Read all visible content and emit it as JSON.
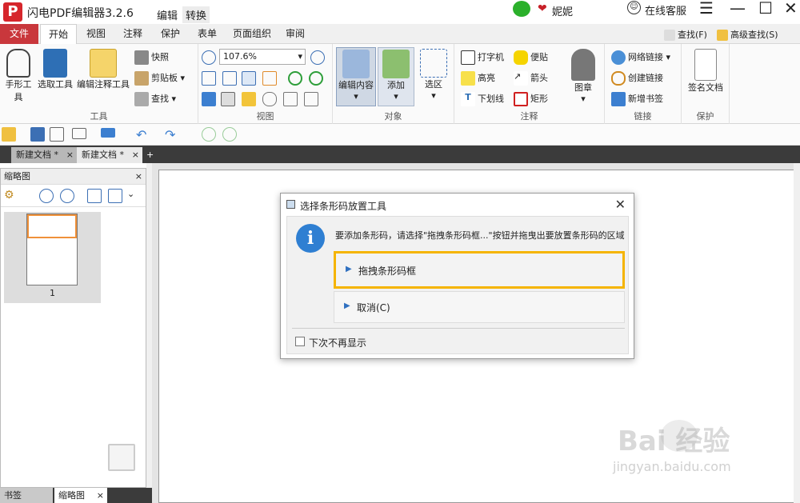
{
  "app": {
    "title": "闪电PDF编辑器3.2.6",
    "logo_text": "P",
    "menu": [
      "编辑",
      "转换"
    ],
    "user": "妮妮",
    "online_service": "在线客服"
  },
  "tabs": [
    "文件",
    "开始",
    "视图",
    "注释",
    "保护",
    "表单",
    "页面组织",
    "审阅"
  ],
  "ribbon_right": {
    "find": "查找(F)",
    "advanced_find": "高级查找(S)"
  },
  "ribbon": {
    "tools": {
      "caption": "工具",
      "hand": "手形工具",
      "select": "选取工具",
      "edit_annot": "编辑注释工具",
      "snapshot": "快照",
      "clipboard": "剪贴板",
      "find": "查找"
    },
    "view": {
      "caption": "视图",
      "zoom": "107.6%"
    },
    "object": {
      "caption": "对象",
      "edit_content": "编辑内容",
      "add": "添加",
      "select_area": "选区"
    },
    "comment": {
      "caption": "注释",
      "typewriter": "打字机",
      "sticky": "便贴",
      "highlight": "高亮",
      "arrow": "箭头",
      "underline": "下划线",
      "rect": "矩形",
      "stamp": "图章"
    },
    "link": {
      "caption": "链接",
      "web_link": "网络链接",
      "create_link": "创建链接",
      "new_bookmark": "新增书签"
    },
    "protect": {
      "caption": "保护",
      "sign": "签名文档"
    }
  },
  "doc_tabs": [
    "新建文档 *",
    "新建文档 *"
  ],
  "sidebar": {
    "title": "缩略图",
    "page_number": "1",
    "bottom_tabs": [
      "书签",
      "缩略图"
    ]
  },
  "dialog": {
    "title": "选择条形码放置工具",
    "message": "要添加条形码，请选择\"拖拽条形码框...\"按钮并拖曳出要放置条形码的区域",
    "option1": "拖拽条形码框",
    "option2": "取消(C)",
    "checkbox": "下次不再显示",
    "info_glyph": "i"
  },
  "watermark": {
    "text": "Bai 经验",
    "sub": "jingyan.baidu.com"
  }
}
